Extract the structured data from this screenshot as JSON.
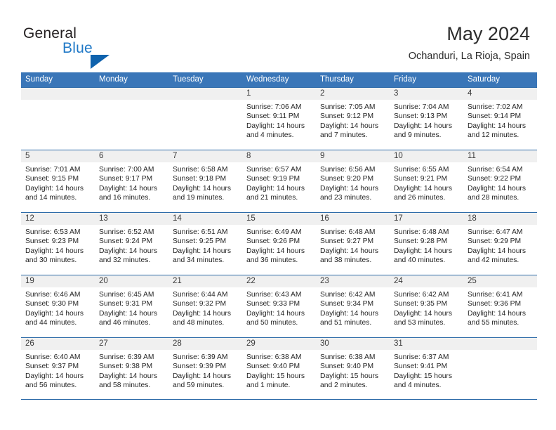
{
  "brand": {
    "name_top": "General",
    "name_bottom": "Blue",
    "flag_icon": "blue-triangle-flag",
    "accent_color": "#2079c7",
    "flag_color": "#0f62ad"
  },
  "header": {
    "title": "May 2024",
    "subtitle": "Ochanduri, La Rioja, Spain"
  },
  "calendar": {
    "header_bg": "#3a76b8",
    "row_border_color": "#2c6aa8",
    "day_band_bg": "#f0f0f0",
    "weekdays": [
      "Sunday",
      "Monday",
      "Tuesday",
      "Wednesday",
      "Thursday",
      "Friday",
      "Saturday"
    ],
    "weeks": [
      [
        {
          "day": "",
          "lines": []
        },
        {
          "day": "",
          "lines": []
        },
        {
          "day": "",
          "lines": []
        },
        {
          "day": "1",
          "lines": [
            "Sunrise: 7:06 AM",
            "Sunset: 9:11 PM",
            "Daylight: 14 hours",
            "and 4 minutes."
          ]
        },
        {
          "day": "2",
          "lines": [
            "Sunrise: 7:05 AM",
            "Sunset: 9:12 PM",
            "Daylight: 14 hours",
            "and 7 minutes."
          ]
        },
        {
          "day": "3",
          "lines": [
            "Sunrise: 7:04 AM",
            "Sunset: 9:13 PM",
            "Daylight: 14 hours",
            "and 9 minutes."
          ]
        },
        {
          "day": "4",
          "lines": [
            "Sunrise: 7:02 AM",
            "Sunset: 9:14 PM",
            "Daylight: 14 hours",
            "and 12 minutes."
          ]
        }
      ],
      [
        {
          "day": "5",
          "lines": [
            "Sunrise: 7:01 AM",
            "Sunset: 9:15 PM",
            "Daylight: 14 hours",
            "and 14 minutes."
          ]
        },
        {
          "day": "6",
          "lines": [
            "Sunrise: 7:00 AM",
            "Sunset: 9:17 PM",
            "Daylight: 14 hours",
            "and 16 minutes."
          ]
        },
        {
          "day": "7",
          "lines": [
            "Sunrise: 6:58 AM",
            "Sunset: 9:18 PM",
            "Daylight: 14 hours",
            "and 19 minutes."
          ]
        },
        {
          "day": "8",
          "lines": [
            "Sunrise: 6:57 AM",
            "Sunset: 9:19 PM",
            "Daylight: 14 hours",
            "and 21 minutes."
          ]
        },
        {
          "day": "9",
          "lines": [
            "Sunrise: 6:56 AM",
            "Sunset: 9:20 PM",
            "Daylight: 14 hours",
            "and 23 minutes."
          ]
        },
        {
          "day": "10",
          "lines": [
            "Sunrise: 6:55 AM",
            "Sunset: 9:21 PM",
            "Daylight: 14 hours",
            "and 26 minutes."
          ]
        },
        {
          "day": "11",
          "lines": [
            "Sunrise: 6:54 AM",
            "Sunset: 9:22 PM",
            "Daylight: 14 hours",
            "and 28 minutes."
          ]
        }
      ],
      [
        {
          "day": "12",
          "lines": [
            "Sunrise: 6:53 AM",
            "Sunset: 9:23 PM",
            "Daylight: 14 hours",
            "and 30 minutes."
          ]
        },
        {
          "day": "13",
          "lines": [
            "Sunrise: 6:52 AM",
            "Sunset: 9:24 PM",
            "Daylight: 14 hours",
            "and 32 minutes."
          ]
        },
        {
          "day": "14",
          "lines": [
            "Sunrise: 6:51 AM",
            "Sunset: 9:25 PM",
            "Daylight: 14 hours",
            "and 34 minutes."
          ]
        },
        {
          "day": "15",
          "lines": [
            "Sunrise: 6:49 AM",
            "Sunset: 9:26 PM",
            "Daylight: 14 hours",
            "and 36 minutes."
          ]
        },
        {
          "day": "16",
          "lines": [
            "Sunrise: 6:48 AM",
            "Sunset: 9:27 PM",
            "Daylight: 14 hours",
            "and 38 minutes."
          ]
        },
        {
          "day": "17",
          "lines": [
            "Sunrise: 6:48 AM",
            "Sunset: 9:28 PM",
            "Daylight: 14 hours",
            "and 40 minutes."
          ]
        },
        {
          "day": "18",
          "lines": [
            "Sunrise: 6:47 AM",
            "Sunset: 9:29 PM",
            "Daylight: 14 hours",
            "and 42 minutes."
          ]
        }
      ],
      [
        {
          "day": "19",
          "lines": [
            "Sunrise: 6:46 AM",
            "Sunset: 9:30 PM",
            "Daylight: 14 hours",
            "and 44 minutes."
          ]
        },
        {
          "day": "20",
          "lines": [
            "Sunrise: 6:45 AM",
            "Sunset: 9:31 PM",
            "Daylight: 14 hours",
            "and 46 minutes."
          ]
        },
        {
          "day": "21",
          "lines": [
            "Sunrise: 6:44 AM",
            "Sunset: 9:32 PM",
            "Daylight: 14 hours",
            "and 48 minutes."
          ]
        },
        {
          "day": "22",
          "lines": [
            "Sunrise: 6:43 AM",
            "Sunset: 9:33 PM",
            "Daylight: 14 hours",
            "and 50 minutes."
          ]
        },
        {
          "day": "23",
          "lines": [
            "Sunrise: 6:42 AM",
            "Sunset: 9:34 PM",
            "Daylight: 14 hours",
            "and 51 minutes."
          ]
        },
        {
          "day": "24",
          "lines": [
            "Sunrise: 6:42 AM",
            "Sunset: 9:35 PM",
            "Daylight: 14 hours",
            "and 53 minutes."
          ]
        },
        {
          "day": "25",
          "lines": [
            "Sunrise: 6:41 AM",
            "Sunset: 9:36 PM",
            "Daylight: 14 hours",
            "and 55 minutes."
          ]
        }
      ],
      [
        {
          "day": "26",
          "lines": [
            "Sunrise: 6:40 AM",
            "Sunset: 9:37 PM",
            "Daylight: 14 hours",
            "and 56 minutes."
          ]
        },
        {
          "day": "27",
          "lines": [
            "Sunrise: 6:39 AM",
            "Sunset: 9:38 PM",
            "Daylight: 14 hours",
            "and 58 minutes."
          ]
        },
        {
          "day": "28",
          "lines": [
            "Sunrise: 6:39 AM",
            "Sunset: 9:39 PM",
            "Daylight: 14 hours",
            "and 59 minutes."
          ]
        },
        {
          "day": "29",
          "lines": [
            "Sunrise: 6:38 AM",
            "Sunset: 9:40 PM",
            "Daylight: 15 hours",
            "and 1 minute."
          ]
        },
        {
          "day": "30",
          "lines": [
            "Sunrise: 6:38 AM",
            "Sunset: 9:40 PM",
            "Daylight: 15 hours",
            "and 2 minutes."
          ]
        },
        {
          "day": "31",
          "lines": [
            "Sunrise: 6:37 AM",
            "Sunset: 9:41 PM",
            "Daylight: 15 hours",
            "and 4 minutes."
          ]
        },
        {
          "day": "",
          "lines": []
        }
      ]
    ]
  }
}
